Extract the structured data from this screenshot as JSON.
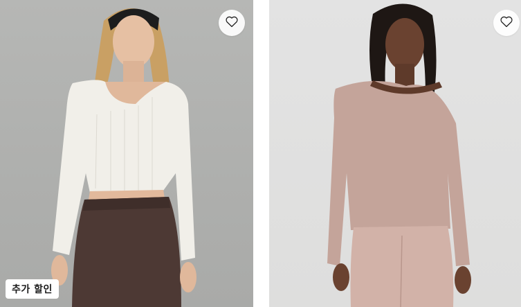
{
  "products": [
    {
      "id_label": "product-left",
      "badge": "추가 할인",
      "favorite_icon": "heart-outline-icon",
      "colors": {
        "shirt": "#f1efe9",
        "pants": "#4d3934",
        "background": "#b0b1af"
      }
    },
    {
      "id_label": "product-right",
      "favorite_icon": "heart-outline-icon",
      "colors": {
        "shirt": "#c4a49a",
        "pants": "#d2b2a8",
        "background": "#e1e1e0"
      }
    }
  ]
}
